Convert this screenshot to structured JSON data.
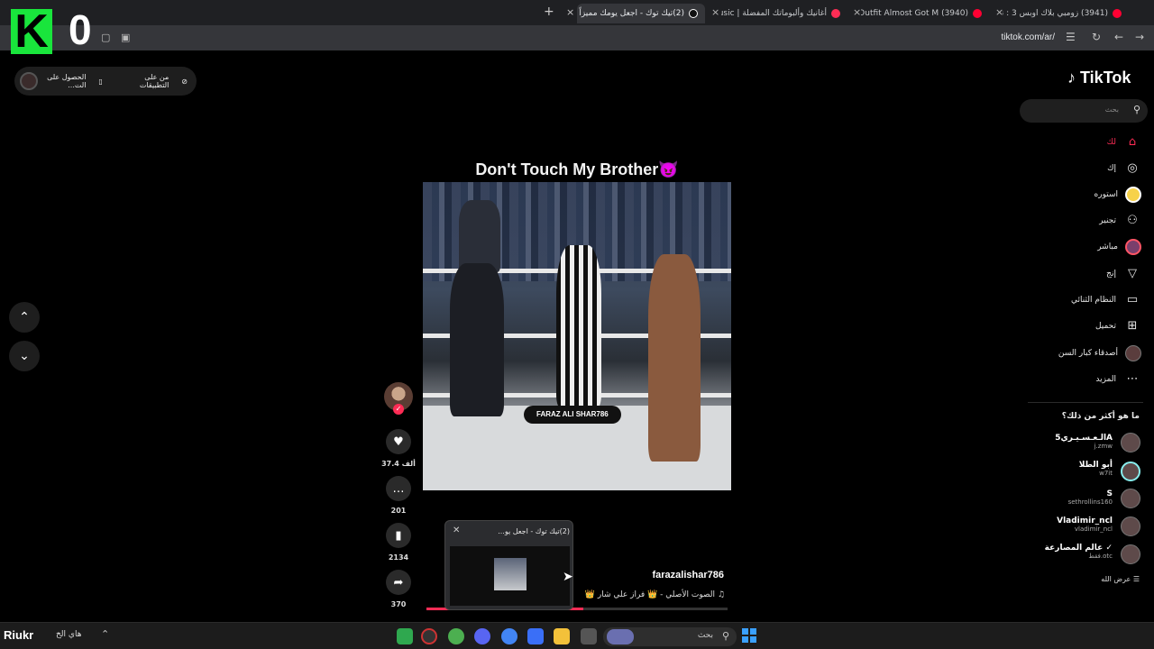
{
  "browser": {
    "tabs": [
      {
        "label": "(3941) زومبي بلاك اوبس 3 : نيوك",
        "color": "#ff0033"
      },
      {
        "label": "(3940) This Outfit Almost Got M",
        "color": "#ff0033"
      },
      {
        "label": "أغانيك وألبوماتك المفضلة | Music",
        "color": "#ff2d55"
      },
      {
        "label": "(2)تيك توك - اجعل يومك مميزاً",
        "color": "#ffffff"
      }
    ],
    "new_tab": "+",
    "url": "tiktok.com/ar/"
  },
  "overlay": {
    "logo_letter": "K",
    "count": "0"
  },
  "get_app": {
    "label1": "من على التطبيقات",
    "label2": "الحصول على الت..."
  },
  "video": {
    "title": "Don't Touch My Brother",
    "title_emoji": "😈",
    "watermark": "FARAZ ALI SHAR786",
    "username": "farazalishar786",
    "music": "الصوت الأصلي - 👑 فراز علي شار 👑",
    "progress": 0.52
  },
  "actions": {
    "likes": "37.4 ألف",
    "comments": "201",
    "saves": "2134",
    "shares": "370"
  },
  "preview": {
    "title": "(2)تيك توك - اجعل يو..."
  },
  "sidebar": {
    "logo": "TikTok",
    "search_placeholder": "بحث",
    "nav": [
      {
        "label": "لك",
        "icon": "home-icon"
      },
      {
        "label": "إك",
        "icon": "compass-icon"
      },
      {
        "label": "استوره",
        "icon": "live-icon"
      },
      {
        "label": "تجنير",
        "icon": "following-icon"
      },
      {
        "label": "مباشر",
        "icon": "live-avatar-icon"
      },
      {
        "label": "إنج",
        "icon": "inbox-icon"
      },
      {
        "label": "النظام الثنائي",
        "icon": "messages-icon"
      },
      {
        "label": "تحميل",
        "icon": "upload-icon"
      },
      {
        "label": "أصدقاء كبار السن",
        "icon": "profile-avatar-icon"
      },
      {
        "label": "المزيد",
        "icon": "more-icon"
      }
    ],
    "section_title": "ما هو أكثر من ذلك؟",
    "accounts": [
      {
        "name": "الـعـسـيـري5A",
        "handle": "j.zmw"
      },
      {
        "name": "أبو الطلا",
        "handle": "w7it"
      },
      {
        "name": "S",
        "handle": "sethrollins160"
      },
      {
        "name": "Vladimir_ncl",
        "handle": "vladimir_ncl"
      },
      {
        "name": "عالم المصارعة ✓",
        "handle": "فقط.otc"
      }
    ],
    "show_all": "عرض الله"
  },
  "taskbar": {
    "brand": "Riukr",
    "tray_text": "هاي الخ",
    "search": "بحث"
  }
}
